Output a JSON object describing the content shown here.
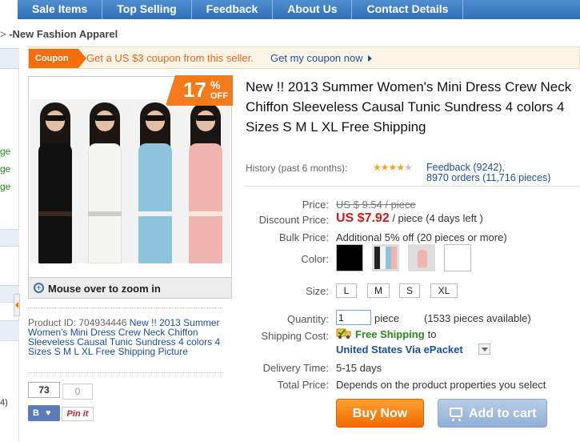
{
  "nav": {
    "items": [
      "Sale Items",
      "Top Selling",
      "Feedback",
      "About Us",
      "Contact Details"
    ]
  },
  "breadcrumb": {
    "arrow": ">",
    "category": "-New Fashion Apparel"
  },
  "left_strip": {
    "ge_items": [
      "ge",
      "ge",
      "ge"
    ],
    "trailing": "4)"
  },
  "coupon": {
    "tag": "Coupon",
    "text": "Get a US $3 coupon from this seller.",
    "link": "Get my coupon now"
  },
  "gallery": {
    "discount_number": "17",
    "discount_percent": "%",
    "discount_off": "OFF",
    "zoom_text": "Mouse over to zoom in"
  },
  "product_id": {
    "label": "Product ID: 704934446",
    "title_link": "New !! 2013 Summer Women's Mini Dress Crew Neck Chiffon Sleeveless Causal Tunic Sundress 4 colors 4 Sizes S M L XL Free Shipping Picture"
  },
  "social": {
    "b_count": "73",
    "pin_count": "0",
    "b_label": "B",
    "pin_label": "Pin it"
  },
  "product": {
    "title": "New !! 2013 Summer Women's Mini Dress Crew Neck Chiffon Sleeveless Causal Tunic Sundress 4 colors 4 Sizes S M L XL Free Shipping",
    "history_label": "History (past 6 months):",
    "rating_stars": 4.5,
    "feedback_line1": "Feedback (9242),",
    "feedback_line2": "8970 orders (11,716 pieces)"
  },
  "details": {
    "price_label": "Price:",
    "price_value": "US $ 9.54 / piece",
    "discount_label": "Discount Price:",
    "discount_value": "US $7.92",
    "discount_suffix": " / piece (4 days left )",
    "bulk_label": "Bulk Price:",
    "bulk_value": "Additional 5% off (20 pieces or more)",
    "color_label": "Color:",
    "colors": [
      "black",
      "multi-photo",
      "pink-photo",
      "white"
    ],
    "size_label": "Size:",
    "sizes": [
      "L",
      "M",
      "S",
      "XL"
    ],
    "quantity_label": "Quantity:",
    "quantity_value": "1",
    "quantity_unit": "piece",
    "quantity_available": "(1533 pieces available)",
    "shipping_label": "Shipping Cost:",
    "shipping_free": "Free Shipping",
    "shipping_to": "to",
    "shipping_via": "United States Via ePacket",
    "delivery_label": "Delivery Time:",
    "delivery_value": "5-15 days",
    "total_label": "Total Price:",
    "total_value": "Depends on the product properties you select"
  },
  "actions": {
    "buy_now": "Buy Now",
    "add_to_cart": "Add to cart"
  },
  "colors": {
    "nav_bg": "#3b7cc2",
    "accent_orange": "#f06a00",
    "price_red": "#d11a1a",
    "link_blue": "#1a4f9c",
    "free_ship_green": "#2a8a1a"
  }
}
